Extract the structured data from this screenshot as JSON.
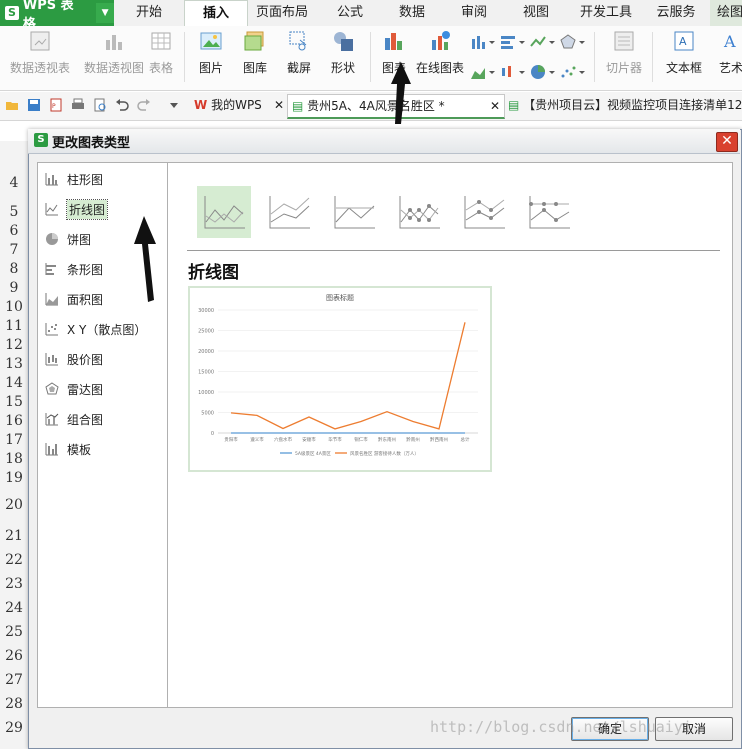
{
  "app": {
    "logo_text": "WPS 表格",
    "brand_color": "#2c9b42"
  },
  "ribbon_tabs": [
    "开始",
    "插入",
    "页面布局",
    "公式",
    "数据",
    "审阅",
    "视图",
    "开发工具",
    "云服务",
    "绘图"
  ],
  "active_tab": "插入",
  "ribbon": {
    "pivot_table": "数据透视表",
    "pivot_chart": "数据透视图",
    "table": "表格",
    "picture": "图片",
    "gallery": "图库",
    "screenshot": "截屏",
    "shapes": "形状",
    "chart": "图表",
    "online_chart": "在线图表",
    "slicer": "切片器",
    "textbox": "文本框",
    "wordart": "艺术"
  },
  "doc_tabs": {
    "mywps": "我的WPS",
    "active_doc": "贵州5A、4A风景名胜区 *",
    "other_doc": "【贵州项目云】视频监控项目连接清单12"
  },
  "row_numbers": [
    "4",
    "5",
    "6",
    "7",
    "8",
    "9",
    "10",
    "11",
    "12",
    "13",
    "14",
    "15",
    "16",
    "17",
    "18",
    "19",
    "20",
    "21",
    "22",
    "23",
    "24",
    "25",
    "26",
    "27",
    "28",
    "29"
  ],
  "dialog": {
    "title": "更改图表类型",
    "close_label": "✕",
    "chart_types": [
      "柱形图",
      "折线图",
      "饼图",
      "条形图",
      "面积图",
      "X Y（散点图）",
      "股价图",
      "雷达图",
      "组合图",
      "模板"
    ],
    "selected_type": "折线图",
    "section_title": "折线图",
    "ok_label": "确定",
    "cancel_label": "取消"
  },
  "chart_data": {
    "type": "line",
    "title": "图表标题",
    "categories": [
      "贵阳市",
      "遵义市",
      "六盘水市",
      "安顺市",
      "毕节市",
      "铜仁市",
      "黔东南州",
      "黔南州",
      "黔西南州",
      "总计"
    ],
    "series": [
      {
        "name": "5A级景区 4A景区",
        "values": [
          0,
          0,
          0,
          0,
          0,
          0,
          0,
          0,
          0,
          0
        ],
        "color": "#5b9bd5"
      },
      {
        "name": "风景名胜区 游客接待人数（万人）",
        "values": [
          4900,
          4300,
          1100,
          3900,
          1000,
          2800,
          5200,
          2800,
          1000,
          27000
        ],
        "color": "#ed7d31"
      }
    ],
    "ylim": [
      0,
      30000
    ],
    "yticks": [
      "0",
      "5000",
      "10000",
      "15000",
      "20000",
      "25000",
      "30000"
    ],
    "legend": "bottom"
  },
  "watermark": "http://blog.csdn.net/lshuaiyi"
}
